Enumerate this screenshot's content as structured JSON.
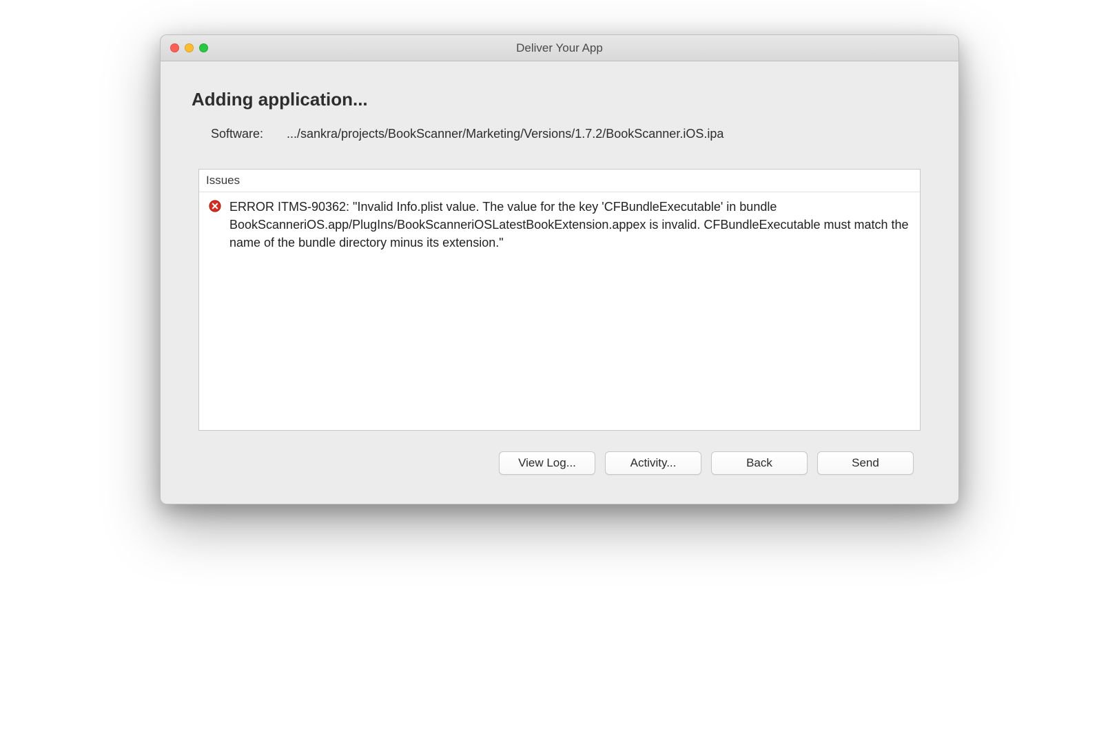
{
  "window": {
    "title": "Deliver Your App"
  },
  "heading": "Adding application...",
  "software": {
    "label": "Software:",
    "path": ".../sankra/projects/BookScanner/Marketing/Versions/1.7.2/BookScanner.iOS.ipa"
  },
  "issues": {
    "header": "Issues",
    "items": [
      {
        "icon": "error",
        "message": "ERROR ITMS-90362: \"Invalid Info.plist value. The value for the key 'CFBundleExecutable' in bundle BookScanneriOS.app/PlugIns/BookScanneriOSLatestBookExtension.appex is invalid. CFBundleExecutable must match the name of the bundle directory minus its extension.\""
      }
    ]
  },
  "buttons": {
    "view_log": "View Log...",
    "activity": "Activity...",
    "back": "Back",
    "send": "Send"
  }
}
